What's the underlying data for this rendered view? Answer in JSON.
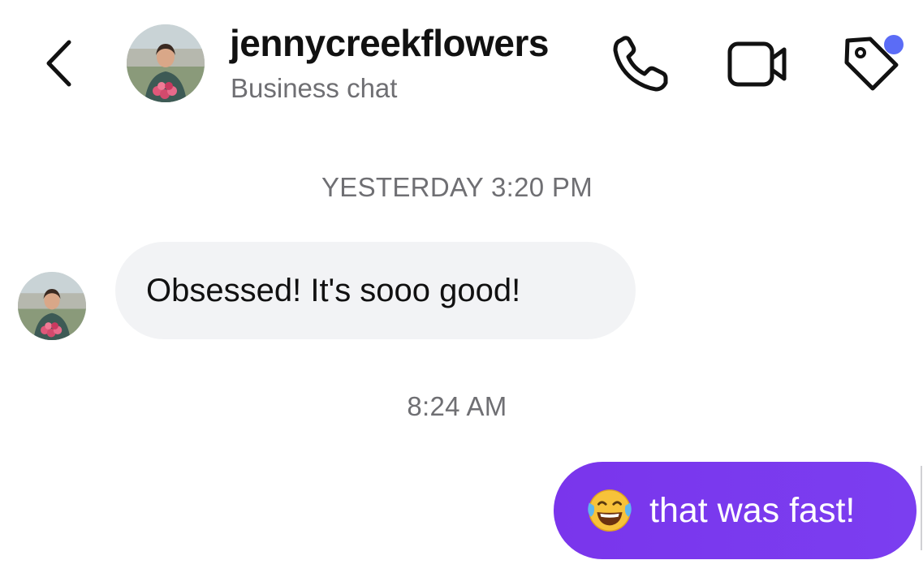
{
  "header": {
    "username": "jennycreekflowers",
    "subtitle": "Business chat",
    "icons": {
      "back": "chevron-left-icon",
      "call": "phone-icon",
      "video": "video-camera-icon",
      "tag": "tag-icon"
    },
    "notification_dot_color": "#5b6cf6"
  },
  "messages": [
    {
      "timestamp": "YESTERDAY 3:20 PM",
      "direction": "incoming",
      "text": "Obsessed! It's sooo good!"
    },
    {
      "timestamp": "8:24 AM",
      "direction": "outgoing",
      "emoji": "tears-of-joy-emoji",
      "text": "that was fast!"
    }
  ],
  "colors": {
    "incoming_bubble": "#f2f3f5",
    "outgoing_bubble": "#7a35ec",
    "muted_text": "#6f6f73"
  }
}
